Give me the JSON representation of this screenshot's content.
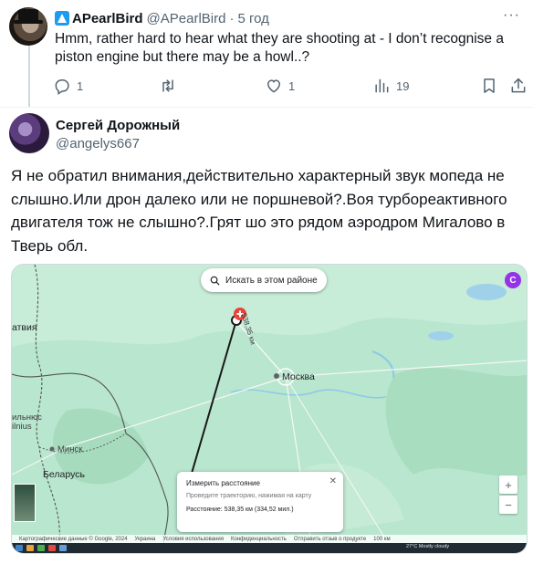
{
  "reply": {
    "name": "APearlBird",
    "handle": "@APearlBird",
    "separator": "·",
    "time": "5 год",
    "text": "Hmm, rather hard to hear what they are shooting at - I don’t recognise a piston engine but there may be a howl..?",
    "replies": "1",
    "likes": "1",
    "views": "19",
    "more": "···"
  },
  "tweet": {
    "name": "Сергей Дорожный",
    "handle": "@angelys667",
    "text": "Я не обратил внимания,действительно характерный звук мопеда не слышно.Или дрон далеко или не поршневой?.Воя турбореактивного двигателя тож не слышно?.Грят шо это рядом аэродром Мигалово в Тверь обл."
  },
  "map": {
    "search_label": "Искать в этом районе",
    "user_initial": "C",
    "labels": {
      "moscow": "Москва",
      "minsk": "Минск",
      "belarus": "Беларусь",
      "latvia": "атвия",
      "vilnius_1": "ильнюс",
      "vilnius_2": "ilnius",
      "distance_tag": "538,35 км"
    },
    "measure": {
      "title": "Измерить расстояние",
      "hint": "Проведите траекторию, нажимая на карту",
      "distance": "Расстояние: 538,35 км (334,52 мил.)",
      "close": "✕"
    },
    "zoom_in": "+",
    "zoom_out": "−",
    "attribution": [
      "Картографические данные © Google, 2024",
      "Украина",
      "Условия использования",
      "Конфиденциальность",
      "Отправить отзыв о продукте",
      "100 км"
    ],
    "weather": "27°C  Mostly cloudy"
  },
  "colors": {
    "accent": "#1d9bf0",
    "muted": "#536471",
    "map_green": "#b9e6cf",
    "route": "#1a1a1a"
  }
}
